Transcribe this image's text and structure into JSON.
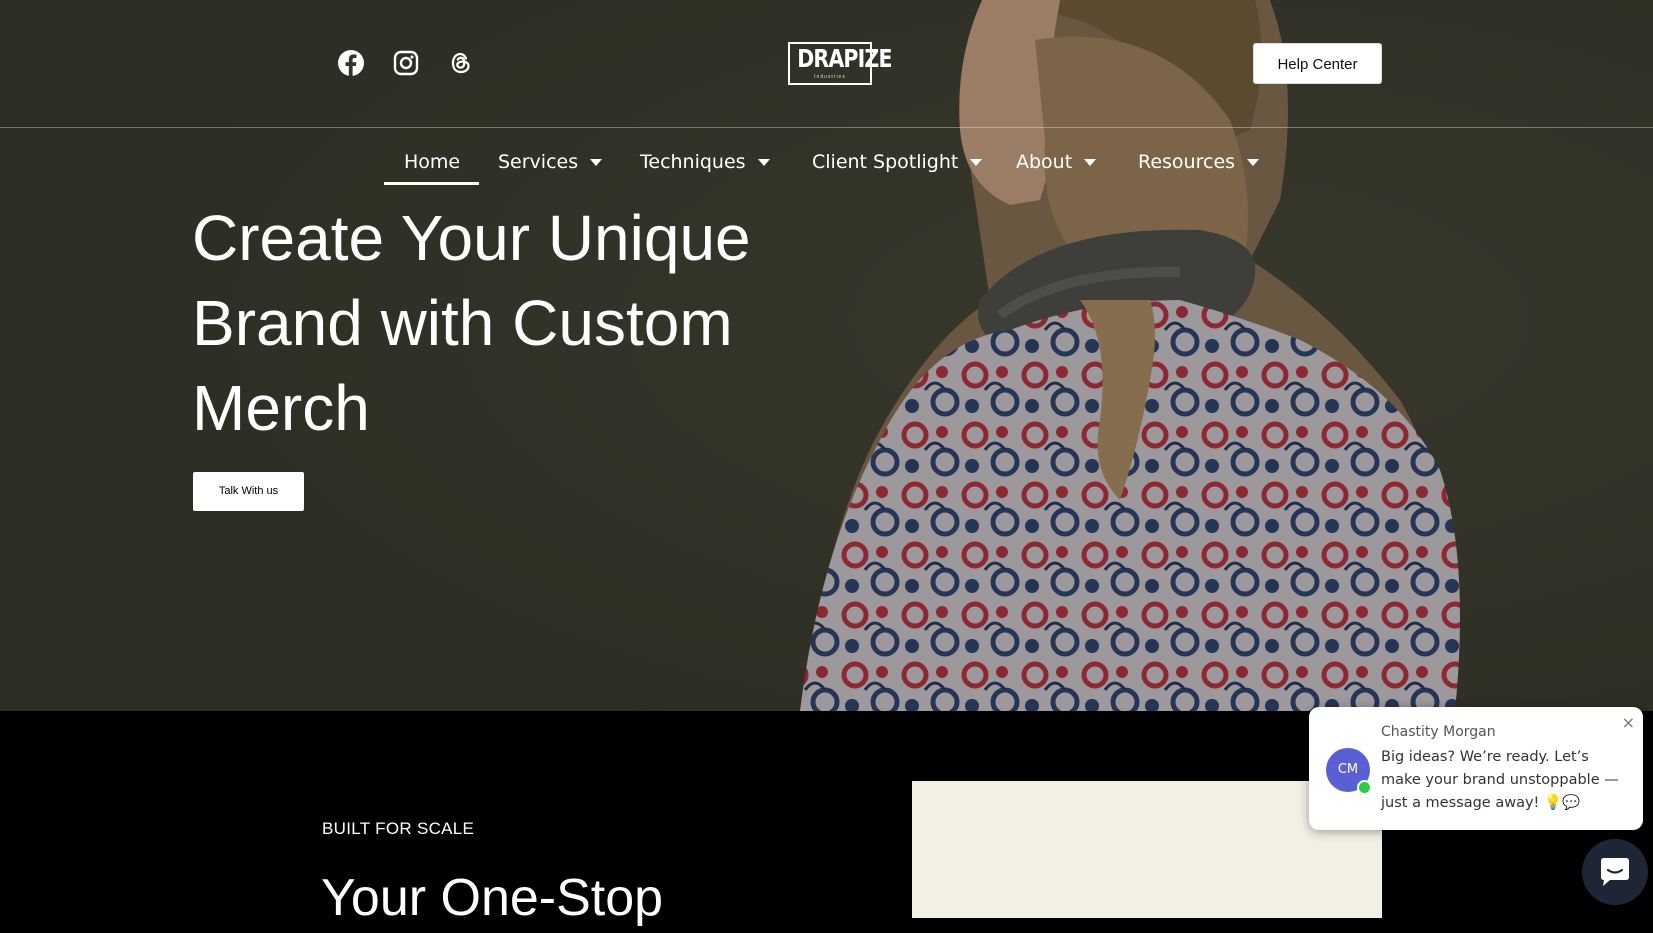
{
  "header": {
    "social": [
      {
        "name": "facebook-icon"
      },
      {
        "name": "instagram-icon"
      },
      {
        "name": "threads-icon"
      }
    ],
    "logo": {
      "main": "DRAPIZE",
      "sub": "Industries"
    },
    "help_center_label": "Help Center"
  },
  "nav": {
    "items": [
      {
        "label": "Home",
        "active": true
      },
      {
        "label": "Services",
        "dropdown": true
      },
      {
        "label": "Techniques",
        "dropdown": true
      },
      {
        "label": "Client Spotlight",
        "dropdown": true
      },
      {
        "label": "About",
        "dropdown": true
      },
      {
        "label": "Resources",
        "dropdown": true
      }
    ]
  },
  "hero": {
    "title": "Create Your Unique Brand with Custom Merch",
    "cta_label": "Talk With us"
  },
  "section": {
    "eyebrow": "BUILT FOR SCALE",
    "title": "Your One-Stop"
  },
  "chat": {
    "agent_name": "Chastity Morgan",
    "agent_initials": "CM",
    "message": "Big ideas? We’re ready. Let’s make your brand unstoppable — just a message away! 💡💬",
    "close_label": "×"
  },
  "colors": {
    "hero_bg": "#34342a",
    "avatar": "#5a5fd6",
    "online": "#2ecc40",
    "launcher": "#1e2535"
  }
}
